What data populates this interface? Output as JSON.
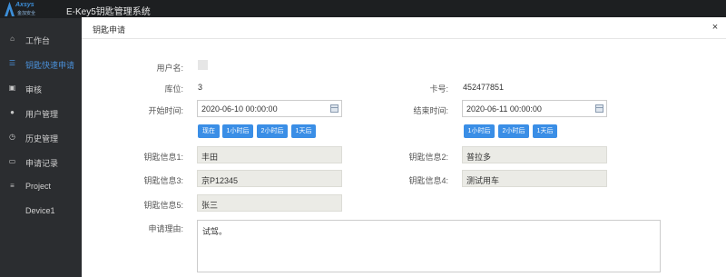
{
  "header": {
    "logo_text": "Axsys",
    "logo_sub": "金加安全",
    "app_title": "E-Key5钥匙管理系统"
  },
  "sidebar": {
    "items": [
      {
        "label": "工作台",
        "icon": "home-icon",
        "glyph": "⌂"
      },
      {
        "label": "钥匙快速申请",
        "icon": "list-icon",
        "glyph": "☰"
      },
      {
        "label": "审核",
        "icon": "audit-icon",
        "glyph": "▣"
      },
      {
        "label": "用户管理",
        "icon": "users-icon",
        "glyph": "●"
      },
      {
        "label": "历史管理",
        "icon": "history-icon",
        "glyph": "◷"
      },
      {
        "label": "申请记录",
        "icon": "record-icon",
        "glyph": "▭"
      },
      {
        "label": "Project",
        "icon": "menu-icon",
        "glyph": "≡"
      },
      {
        "label": "Device1",
        "icon": "",
        "glyph": ""
      }
    ],
    "active_color": "#4a90d9"
  },
  "modal": {
    "title": "钥匙申请",
    "close": "×",
    "username_label": "用户名:",
    "username_value": "",
    "location_label": "库位:",
    "location_value": "3",
    "card_label": "卡号:",
    "card_value": "452477851",
    "start_label": "开始时间:",
    "start_value": "2020-06-10 00:00:00",
    "end_label": "结束时间:",
    "end_value": "2020-06-11 00:00:00",
    "quick_buttons": [
      "现在",
      "1小时后",
      "2小时后",
      "1天后"
    ],
    "quick_buttons_end": [
      "1小时后",
      "2小时后",
      "1天后"
    ],
    "key_info_1_label": "钥匙信息1:",
    "key_info_1_value": "丰田",
    "key_info_2_label": "钥匙信息2:",
    "key_info_2_value": "普拉多",
    "key_info_3_label": "钥匙信息3:",
    "key_info_3_value": "京P12345",
    "key_info_4_label": "钥匙信息4:",
    "key_info_4_value": "测试用车",
    "key_info_5_label": "钥匙信息5:",
    "key_info_5_value": "张三",
    "reason_label": "申请理由:",
    "reason_value": "试驾。"
  },
  "colors": {
    "topbar": "#1d1f21",
    "sidebar": "#2b2d30",
    "button": "#3a8ee6",
    "readonly_field": "#ebebe6"
  }
}
